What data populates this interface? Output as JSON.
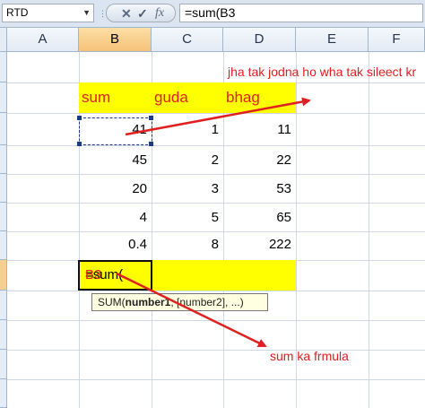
{
  "formula_bar": {
    "name_box": "RTD",
    "cancel_icon": "✕",
    "enter_icon": "✓",
    "fx_label": "fx",
    "formula": "=sum(B3"
  },
  "columns": [
    "A",
    "B",
    "C",
    "D",
    "E",
    "F"
  ],
  "sheet": {
    "headers": {
      "b": "sum",
      "c": "guda",
      "d": "bhag"
    },
    "rows": [
      {
        "b": "41",
        "c": "1",
        "d": "11"
      },
      {
        "b": "45",
        "c": "2",
        "d": "22"
      },
      {
        "b": "20",
        "c": "3",
        "d": "53"
      },
      {
        "b": "4",
        "c": "5",
        "d": "65"
      },
      {
        "b": "0.4",
        "c": "8",
        "d": "222"
      }
    ],
    "active_cell_prefix": "=sum(",
    "active_cell_ref": "B3"
  },
  "tooltip": {
    "fn": "SUM(",
    "arg1": "number1",
    "rest": ", [number2], ...)"
  },
  "annotations": {
    "top": "jha tak jodna ho wha tak sileect kr",
    "bottom": "sum ka frmula"
  },
  "colors": {
    "highlight": "#ffff00",
    "annotation": "#e02020",
    "selected_header": "#f8c684"
  }
}
